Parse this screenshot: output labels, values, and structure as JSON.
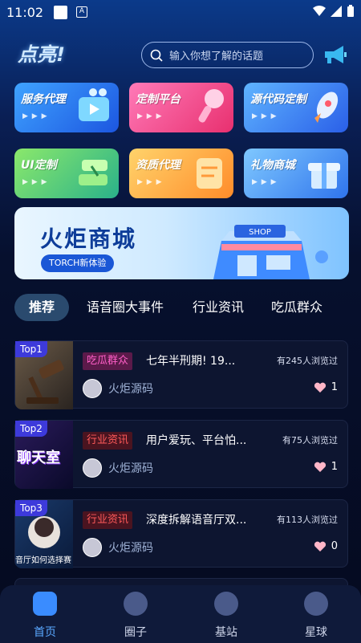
{
  "status_bar": {
    "time": "11:02"
  },
  "header": {
    "logo_text": "点亮!",
    "search_placeholder": "输入你想了解的话题"
  },
  "services": [
    {
      "label": "服务代理",
      "arrows": "▶ ▶ ▶"
    },
    {
      "label": "定制平台",
      "arrows": "▶ ▶ ▶"
    },
    {
      "label": "源代码定制",
      "arrows": "▶ ▶ ▶"
    },
    {
      "label": "UI定制",
      "arrows": "▶ ▶ ▶"
    },
    {
      "label": "资质代理",
      "arrows": "▶ ▶ ▶"
    },
    {
      "label": "礼物商城",
      "arrows": "▶ ▶ ▶"
    }
  ],
  "banner": {
    "title": "火炬商城",
    "subtitle": "TORCH新体验",
    "shop_sign": "SHOP"
  },
  "tabs": [
    "推荐",
    "语音圈大事件",
    "行业资讯",
    "吃瓜群众"
  ],
  "articles": [
    {
      "rank": "Top1",
      "tag": "吃瓜群众",
      "title": "七年半刑期! 19...",
      "views": "有245人浏览过",
      "author": "火炬源码",
      "likes": "1",
      "thumb_text": ""
    },
    {
      "rank": "Top2",
      "tag": "行业资讯",
      "title": "用户爱玩、平台怕...",
      "views": "有75人浏览过",
      "author": "火炬源码",
      "likes": "1",
      "thumb_text": "聊天室"
    },
    {
      "rank": "Top3",
      "tag": "行业资讯",
      "title": "深度拆解语音厅双...",
      "views": "有113人浏览过",
      "author": "火炬源码",
      "likes": "0",
      "thumb_text": "音厅如何选择赛"
    }
  ],
  "bottom_nav": [
    {
      "label": "首页",
      "icon": "home-icon"
    },
    {
      "label": "圈子",
      "icon": "planet-icon"
    },
    {
      "label": "基站",
      "icon": "satellite-icon"
    },
    {
      "label": "星球",
      "icon": "globe-icon"
    }
  ],
  "colors": {
    "accent": "#5aa8ff",
    "tag_gossip_bg": "#5b1a4a",
    "tag_gossip_fg": "#ff5fc8",
    "tag_news_bg": "#4a1420",
    "tag_news_fg": "#ff5a5a",
    "rank_bg": "#3d3adb"
  }
}
